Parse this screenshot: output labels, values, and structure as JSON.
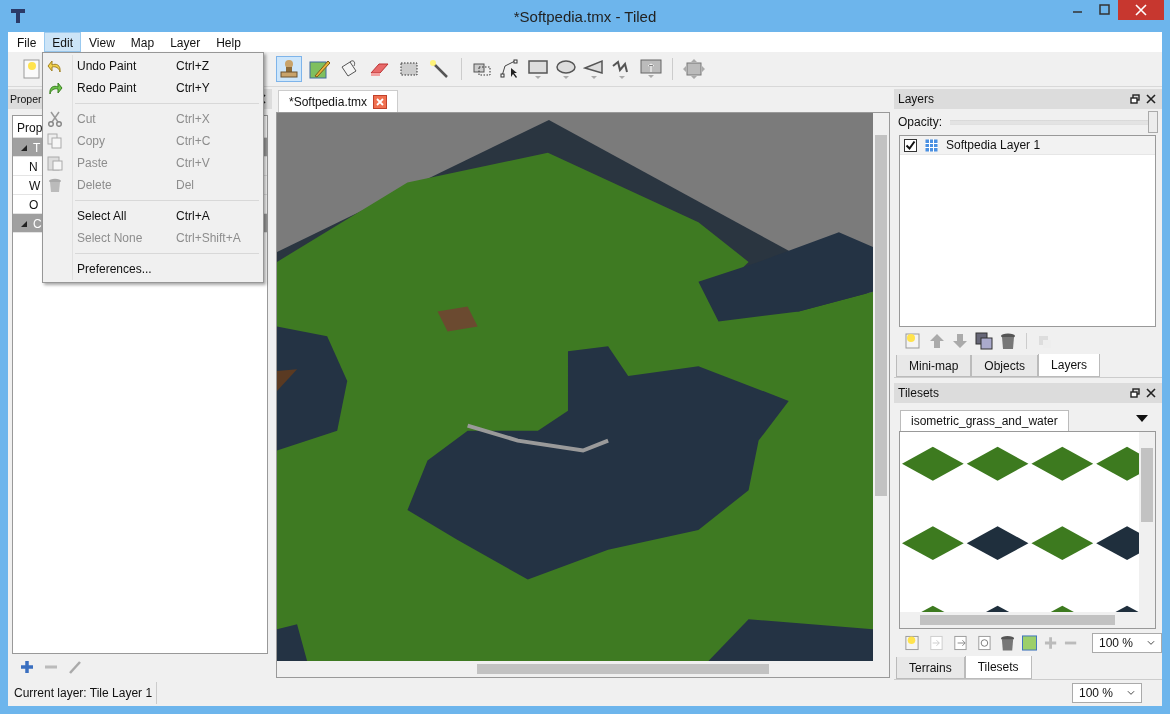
{
  "window": {
    "title": "*Softpedia.tmx - Tiled"
  },
  "menubar": [
    {
      "label": "File",
      "selected": false
    },
    {
      "label": "Edit",
      "selected": true
    },
    {
      "label": "View",
      "selected": false
    },
    {
      "label": "Map",
      "selected": false
    },
    {
      "label": "Layer",
      "selected": false
    },
    {
      "label": "Help",
      "selected": false
    }
  ],
  "edit_menu": {
    "groups": [
      [
        {
          "label": "Undo Paint",
          "shortcut": "Ctrl+Z",
          "disabled": false
        },
        {
          "label": "Redo Paint",
          "shortcut": "Ctrl+Y",
          "disabled": false
        }
      ],
      [
        {
          "label": "Cut",
          "shortcut": "Ctrl+X",
          "disabled": true
        },
        {
          "label": "Copy",
          "shortcut": "Ctrl+C",
          "disabled": true
        },
        {
          "label": "Paste",
          "shortcut": "Ctrl+V",
          "disabled": true
        },
        {
          "label": "Delete",
          "shortcut": "Del",
          "disabled": true
        }
      ],
      [
        {
          "label": "Select All",
          "shortcut": "Ctrl+A",
          "disabled": false
        },
        {
          "label": "Select None",
          "shortcut": "Ctrl+Shift+A",
          "disabled": true
        }
      ],
      [
        {
          "label": "Preferences...",
          "disabled": false
        }
      ]
    ]
  },
  "toolbar": {
    "tools": [
      {
        "kind": "stamp",
        "selected": true
      },
      {
        "kind": "terrain",
        "selected": false
      },
      {
        "kind": "fill",
        "selected": false
      },
      {
        "kind": "eraser",
        "selected": false
      },
      {
        "kind": "rect-select",
        "selected": false
      },
      {
        "kind": "magic-wand",
        "selected": false
      }
    ]
  },
  "properties": {
    "title": "Proper",
    "header": "Prop",
    "rows": [
      {
        "kind": "group",
        "text": "T"
      },
      {
        "kind": "property",
        "text": "N"
      },
      {
        "kind": "property",
        "text": "W"
      },
      {
        "kind": "property",
        "text": "O"
      },
      {
        "kind": "group",
        "text": "C"
      }
    ]
  },
  "document_tabs": [
    {
      "label": "*Softpedia.tmx",
      "selected": true
    }
  ],
  "layers": {
    "title": "Layers",
    "opacity_label": "Opacity:",
    "opacity": {
      "level": 1.0
    },
    "items": [
      {
        "name": "Softpedia Layer 1",
        "visible": true,
        "selected": true
      }
    ],
    "tabs": [
      {
        "label": "Mini-map",
        "selected": false
      },
      {
        "label": "Objects",
        "selected": false
      },
      {
        "label": "Layers",
        "selected": true
      }
    ]
  },
  "tilesets": {
    "title": "Tilesets",
    "tabs": [
      {
        "label": "isometric_grass_and_water",
        "selected": true
      }
    ],
    "zoom": "100 %",
    "bottom_tabs": [
      {
        "label": "Terrains",
        "selected": false
      },
      {
        "label": "Tilesets",
        "selected": true
      }
    ]
  },
  "status_bar": {
    "text": "Current layer: Tile Layer 1",
    "zoom": "100 %"
  }
}
